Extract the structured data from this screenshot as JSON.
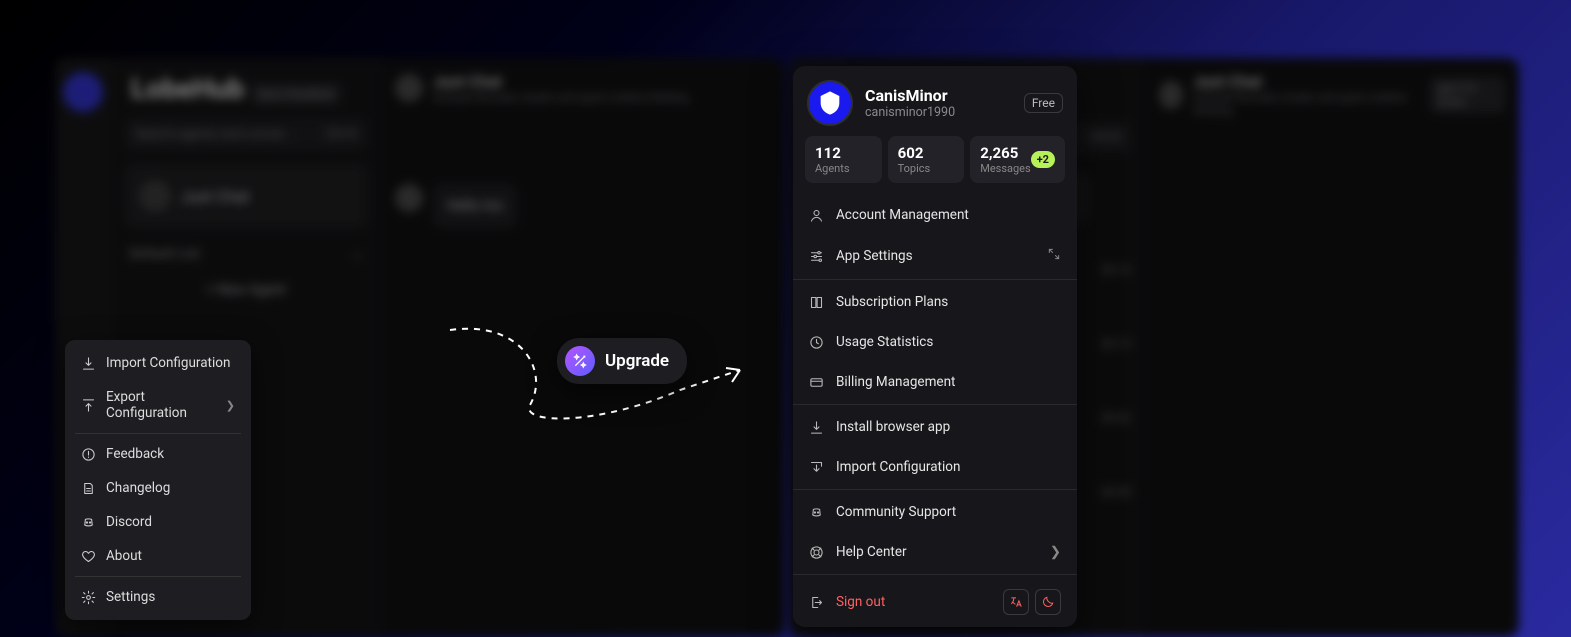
{
  "bg": {
    "brand": "LobeHub",
    "sync": "Sync Disabled",
    "search_placeholder": "Search agents and conver...",
    "search_kbd": "Ctrl K",
    "just_chat": "Just Chat",
    "default_list": "Default List",
    "new_agent": "+  New Agent",
    "header_sub": "Activate the brain cluster and spark creative thinking",
    "model": "gpt-3.5-turbo",
    "bubble": "Hello\nmo",
    "t1": "05-15",
    "t2": "05-15",
    "t3": "05-02",
    "t4": "04-30"
  },
  "left_menu": {
    "import": "Import Configuration",
    "export": "Export Configuration",
    "feedback": "Feedback",
    "changelog": "Changelog",
    "discord": "Discord",
    "about": "About",
    "settings": "Settings"
  },
  "upgrade": {
    "label": "Upgrade"
  },
  "profile": {
    "name": "CanisMinor",
    "handle": "canisminor1990",
    "plan": "Free"
  },
  "stats": {
    "agents_v": "112",
    "agents_l": "Agents",
    "topics_v": "602",
    "topics_l": "Topics",
    "messages_v": "2,265",
    "messages_l": "Messages",
    "extra": "+2"
  },
  "rows": {
    "account": "Account Management",
    "app": "App Settings",
    "subscription": "Subscription Plans",
    "usage": "Usage Statistics",
    "billing": "Billing Management",
    "install": "Install browser app",
    "import": "Import Configuration",
    "community": "Community Support",
    "help": "Help Center",
    "signout": "Sign out"
  }
}
